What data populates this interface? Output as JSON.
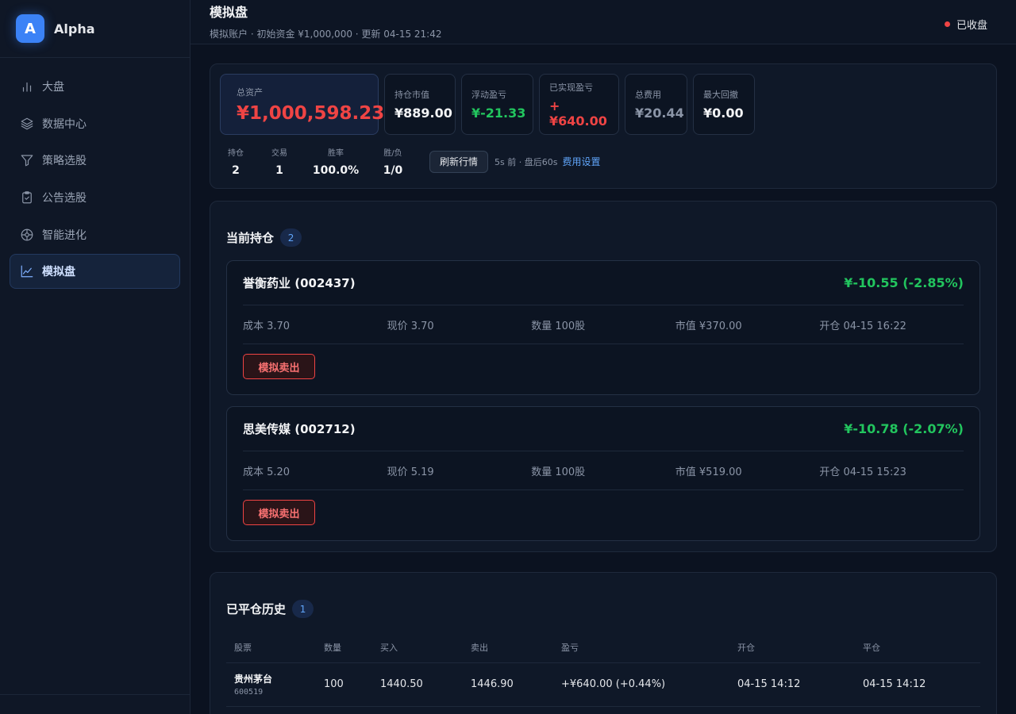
{
  "brand": {
    "logo_letter": "A",
    "name": "Alpha",
    "accent": "#3b82f6"
  },
  "sidebar": {
    "items": [
      {
        "label": "大盘",
        "icon": "bar-chart-icon",
        "active": false
      },
      {
        "label": "数据中心",
        "icon": "layers-icon",
        "active": false
      },
      {
        "label": "策略选股",
        "icon": "filter-icon",
        "active": false
      },
      {
        "label": "公告选股",
        "icon": "clipboard-icon",
        "active": false
      },
      {
        "label": "智能进化",
        "icon": "aperture-icon",
        "active": false
      },
      {
        "label": "模拟盘",
        "icon": "trend-line-icon",
        "active": true
      }
    ]
  },
  "header": {
    "title": "模拟盘",
    "subtitle": "模拟账户 · 初始资金 ¥1,000,000 · 更新 04-15 21:42",
    "status": "已收盘",
    "status_color": "#ef4444"
  },
  "summary": {
    "total_assets": {
      "label": "总资产",
      "value": "¥1,000,598.23"
    },
    "position_value": {
      "label": "持仓市值",
      "value": "¥889.00"
    },
    "floating_pnl": {
      "label": "浮动盈亏",
      "value": "¥-21.33"
    },
    "realized_pnl": {
      "label": "已实现盈亏",
      "value": "+¥640.00"
    },
    "total_fees": {
      "label": "总费用",
      "value": "¥20.44"
    },
    "max_drawdown": {
      "label": "最大回撤",
      "value": "¥0.00"
    },
    "holdings": {
      "label": "持仓",
      "value": "2"
    },
    "trades": {
      "label": "交易",
      "value": "1"
    },
    "win_rate": {
      "label": "胜率",
      "value": "100.0%"
    },
    "win_loss": {
      "label": "胜/负",
      "value": "1/0"
    },
    "refresh_label": "刷新行情",
    "refresh_meta": "5s 前 · 盘后60s",
    "fee_settings_label": "费用设置"
  },
  "positions": {
    "title": "当前持仓",
    "count": "2",
    "sell_label": "模拟卖出",
    "items": [
      {
        "name": "誉衡药业 (002437)",
        "pnl": "¥-10.55 (-2.85%)",
        "cost": "成本 3.70",
        "price": "现价 3.70",
        "qty": "数量 100股",
        "mkt_value": "市值 ¥370.00",
        "opened": "开仓 04-15 16:22"
      },
      {
        "name": "思美传媒 (002712)",
        "pnl": "¥-10.78 (-2.07%)",
        "cost": "成本 5.20",
        "price": "现价 5.19",
        "qty": "数量 100股",
        "mkt_value": "市值 ¥519.00",
        "opened": "开仓 04-15 15:23"
      }
    ]
  },
  "history": {
    "title": "已平仓历史",
    "count": "1",
    "columns": [
      "股票",
      "数量",
      "买入",
      "卖出",
      "盈亏",
      "开仓",
      "平仓"
    ],
    "rows": [
      {
        "name": "贵州茅台",
        "code": "600519",
        "qty": "100",
        "buy": "1440.50",
        "sell": "1446.90",
        "pnl": "+¥640.00 (+0.44%)",
        "opened": "04-15 14:12",
        "closed": "04-15 14:12"
      }
    ]
  }
}
